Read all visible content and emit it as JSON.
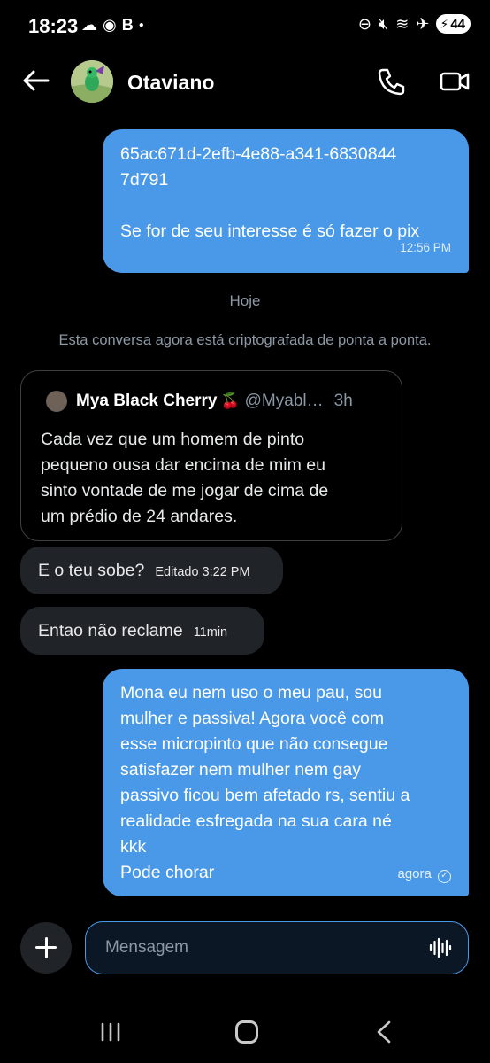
{
  "status_bar": {
    "time": "18:23",
    "battery": "44"
  },
  "header": {
    "contact_name": "Otaviano"
  },
  "messages": [
    {
      "direction": "outgoing",
      "lines": [
        "65ac671d-2efb-4e88-a341-6830844",
        "7d791",
        "",
        "Se for de seu interesse é só fazer o pix"
      ],
      "time": "12:56 PM"
    }
  ],
  "date_separator": "Hoje",
  "encryption_notice": "Esta conversa agora está criptografada de ponta a ponta.",
  "quoted_post": {
    "author_name": "Mya Black Cherry",
    "author_emoji": "🍒",
    "handle": "@Myabl…",
    "time": "3h",
    "text_lines": [
      "Cada vez que um homem de pinto",
      "pequeno ousa dar encima de mim eu",
      "sinto vontade de me jogar de cima de",
      "um prédio de 24 andares."
    ]
  },
  "incoming": [
    {
      "text": "E o teu sobe?",
      "meta": "Editado 3:22 PM"
    },
    {
      "text": "Entao não reclame",
      "meta": "11min"
    }
  ],
  "outgoing_last": {
    "lines": [
      "Mona eu nem uso o meu pau, sou",
      "mulher e passiva! Agora você com",
      "esse micropinto que não consegue",
      "satisfazer nem mulher nem gay",
      "passivo ficou bem afetado rs, sentiu a",
      "realidade esfregada na sua cara né",
      "kkk",
      "Pode chorar"
    ],
    "time": "agora"
  },
  "composer": {
    "placeholder": "Mensagem"
  },
  "colors": {
    "accent": "#4a99e9",
    "incoming_bubble": "#202327",
    "background": "#000000"
  }
}
